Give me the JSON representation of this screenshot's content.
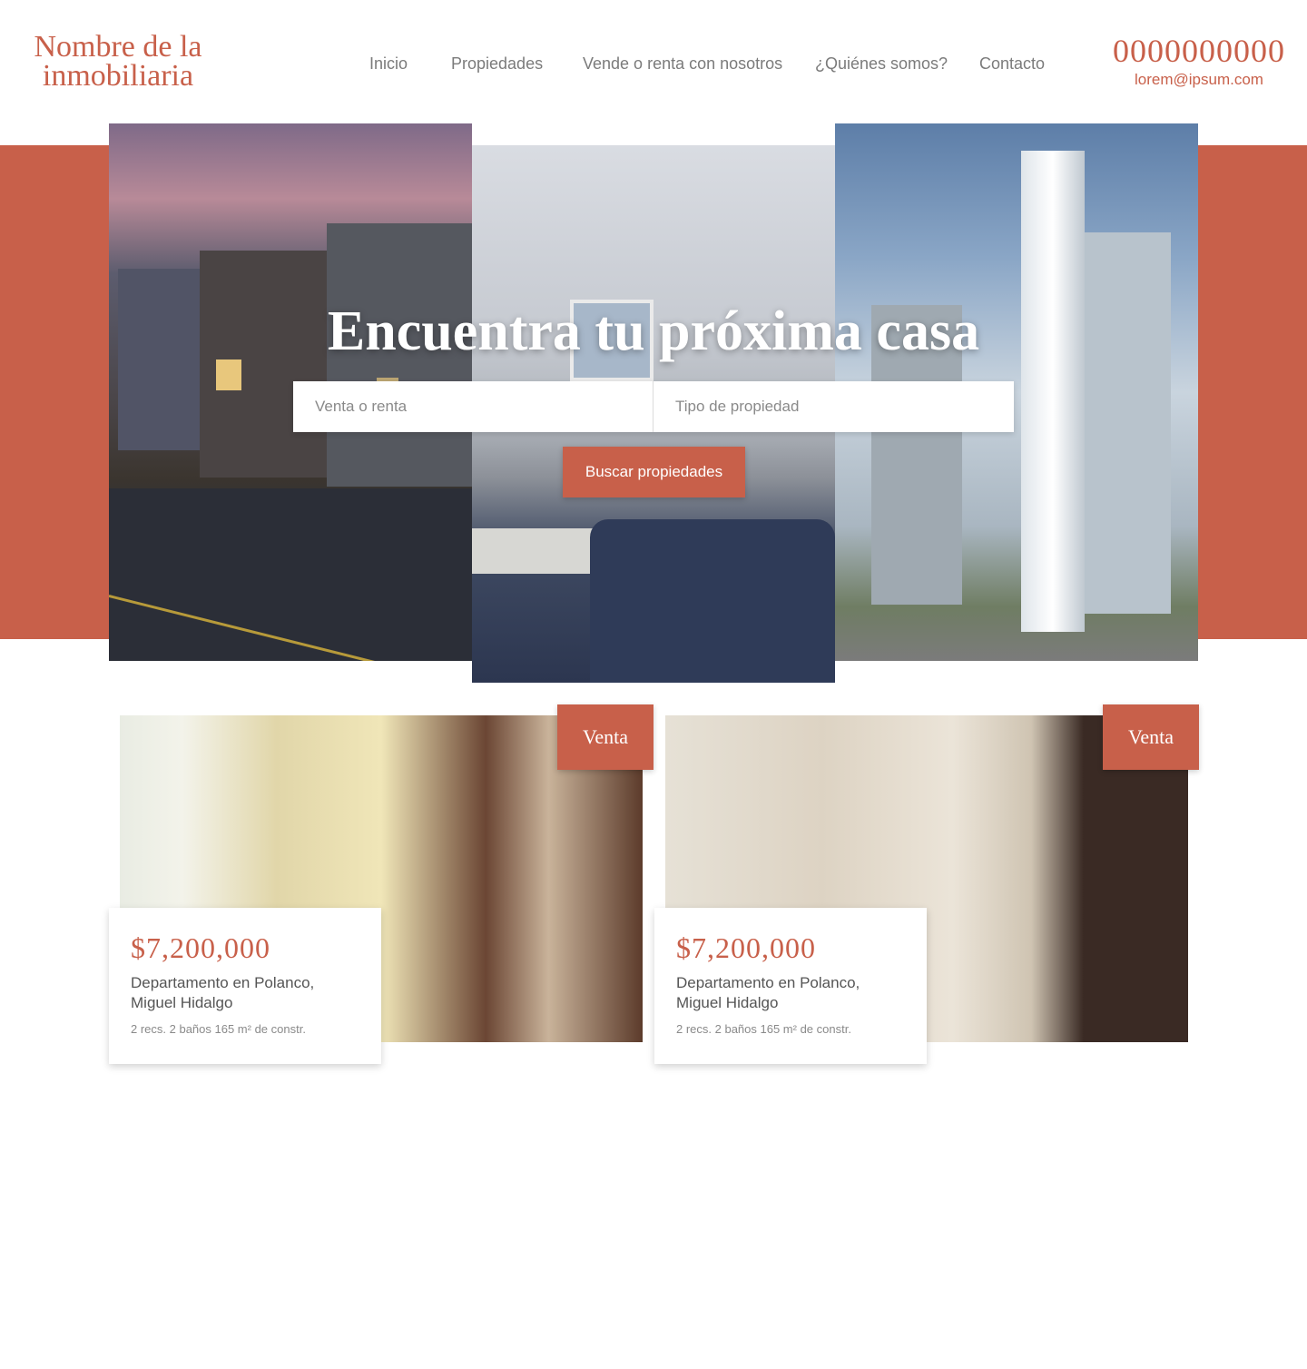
{
  "header": {
    "logo_text": "Nombre de la inmobiliaria",
    "nav": [
      "Inicio",
      "Propiedades",
      "Vende o renta con nosotros",
      "¿Quiénes somos?",
      "Contacto"
    ],
    "phone": "0000000000",
    "email": "lorem@ipsum.com"
  },
  "hero": {
    "title": "Encuentra tu próxima casa",
    "field1_placeholder": "Venta o renta",
    "field2_placeholder": "Tipo de propiedad",
    "button_label": "Buscar propiedades"
  },
  "listings": [
    {
      "badge": "Venta",
      "price": "$7,200,000",
      "description": "Departamento en Polanco, Miguel Hidalgo",
      "specs": "2 recs. 2 baños 165 m² de constr."
    },
    {
      "badge": "Venta",
      "price": "$7,200,000",
      "description": "Departamento en Polanco, Miguel Hidalgo",
      "specs": "2 recs. 2 baños 165 m² de constr."
    }
  ],
  "colors": {
    "accent": "#c8604a",
    "nav_text": "#7b7b7b",
    "background": "#ffffff"
  }
}
